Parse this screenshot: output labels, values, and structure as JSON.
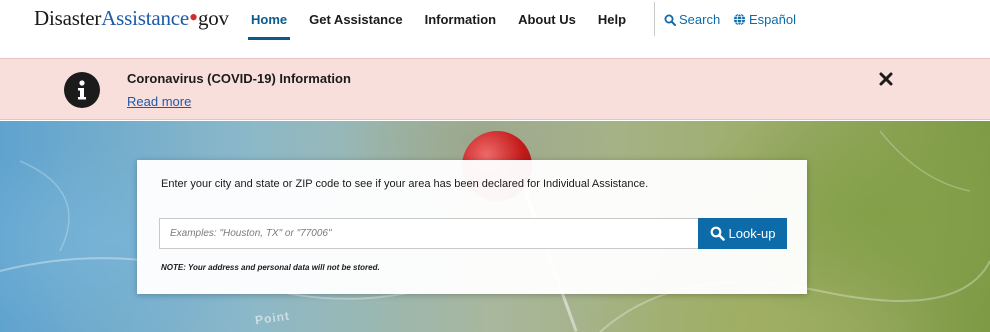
{
  "logo": {
    "part1": "Disaster",
    "part2": "Assistance",
    "part3": "gov"
  },
  "nav": {
    "items": [
      {
        "label": "Home",
        "active": true
      },
      {
        "label": "Get Assistance",
        "active": false
      },
      {
        "label": "Information",
        "active": false
      },
      {
        "label": "About Us",
        "active": false
      },
      {
        "label": "Help",
        "active": false
      }
    ],
    "search_label": "Search",
    "language_label": "Español"
  },
  "alert": {
    "title": "Coronavirus (COVID-19) Information",
    "link": "Read more",
    "icon": "info-icon",
    "background": "#f9dfdb"
  },
  "hero": {
    "map_text": "Point"
  },
  "search": {
    "prompt": "Enter your city and state or ZIP code to see if your area has been declared for Individual Assistance.",
    "placeholder": "Examples: \"Houston, TX\" or \"77006\"",
    "value": "",
    "button_label": "Look-up",
    "note": "NOTE: Your address and personal data will not be stored."
  },
  "colors": {
    "accent": "#0c6ba8",
    "brand_blue": "#1f5aa6",
    "brand_red": "#d42a2a",
    "nav_active": "#0c5a8c"
  }
}
